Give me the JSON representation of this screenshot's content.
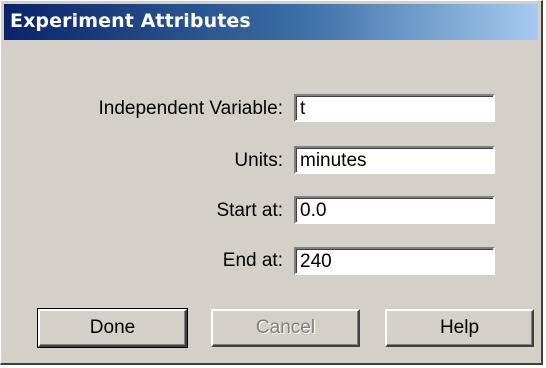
{
  "window": {
    "title": "Experiment Attributes"
  },
  "fields": [
    {
      "label": "Independent Variable:",
      "value": "t"
    },
    {
      "label": "Units:",
      "value": "minutes"
    },
    {
      "label": "Start at:",
      "value": "0.0"
    },
    {
      "label": "End at:",
      "value": "240"
    }
  ],
  "buttons": {
    "done": "Done",
    "cancel": "Cancel",
    "help": "Help"
  },
  "colors": {
    "title_bar_start": "#0a246a",
    "title_bar_end": "#a6caf0",
    "dialog_background": "#d4d0c8",
    "disabled_text": "#808080"
  }
}
